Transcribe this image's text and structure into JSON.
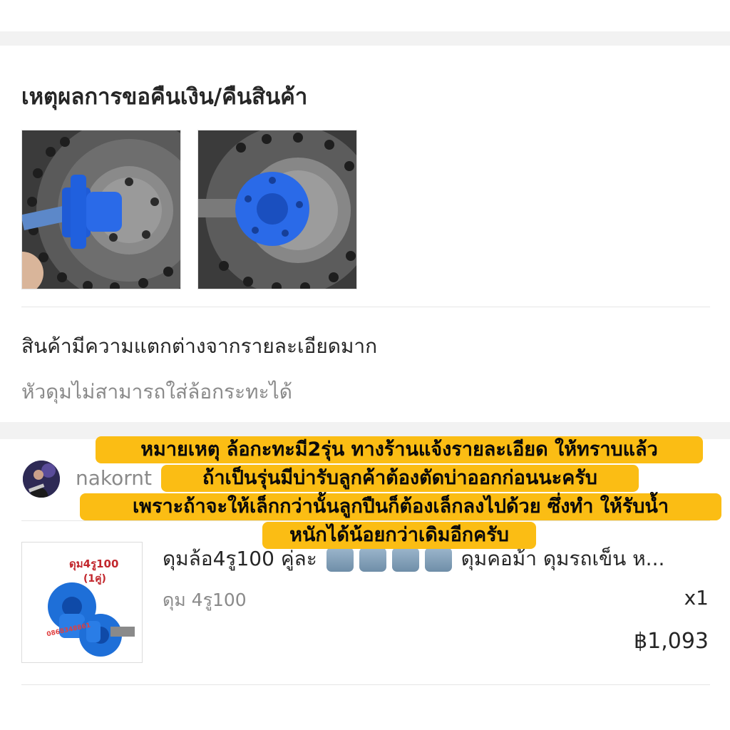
{
  "refund_section": {
    "title": "เหตุผลการขอคืนเงิน/คืนสินค้า",
    "photos": [
      {
        "name": "evidence-photo-1",
        "icon": "blue-wheel-hub-photo"
      },
      {
        "name": "evidence-photo-2",
        "icon": "blue-wheel-hub-photo"
      }
    ],
    "reason": "สินค้ามีความแตกต่างจากรายละเอียดมาก",
    "detail": "หัวดุมไม่สามารถใส่ล้อกระทะได้"
  },
  "seller_note": {
    "lines": [
      "หมายเหตุ ล้อกะทะมี2รุ่น ทางร้านแจ้งรายละเอียด ให้ทราบแล้ว",
      "ถ้าเป็นรุ่นมีบ่ารับลูกค้าต้องตัดบ่าออกก่อนนะครับ",
      "เพราะถ้าจะให้เล็กกว่านั้นลูกปืนก็ต้องเล็กลงไปด้วย ซึ่งทำ ให้รับน้ำ",
      "หนักได้น้อยกว่าเดิมอีกครับ"
    ],
    "highlight_color": "#fbbd14"
  },
  "order": {
    "shop_name": "nakornt",
    "product": {
      "title_start": "ดุมล้อ4รู100 คู่ละ",
      "title_end": "ดุมคอม้า ดุมรถเข็น ห...",
      "thumb_caption": "ดุม4รู100",
      "thumb_caption2": "(1คู่)",
      "thumb_phone": "0868348861",
      "variation": "ดุม 4รู100",
      "quantity": "x1",
      "price": "฿1,093"
    }
  }
}
